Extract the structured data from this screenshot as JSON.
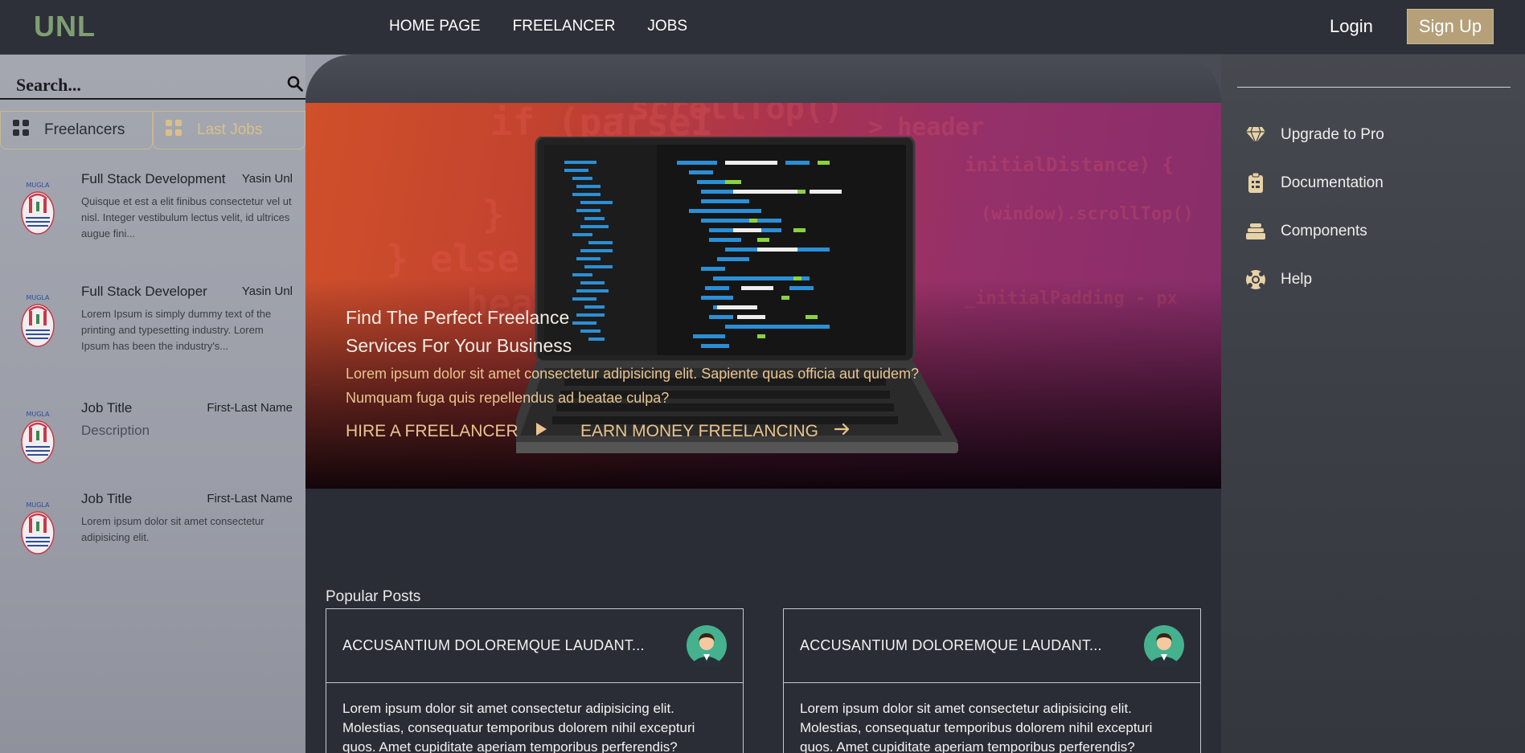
{
  "header": {
    "brand": "UNL",
    "nav": [
      "HOME PAGE",
      "FREELANCER",
      "JOBS"
    ],
    "login": "Login",
    "signup": "Sign Up"
  },
  "sidebar": {
    "search_placeholder": "Search...",
    "tabs": [
      {
        "label": "Freelancers",
        "icon": "grid-icon"
      },
      {
        "label": "Last Jobs",
        "icon": "grid-icon"
      }
    ],
    "jobs": [
      {
        "title": "Full Stack Development",
        "author": "Yasin Unl",
        "description": "Quisque et est a elit finibus consectetur vel ut nisl. Integer vestibulum lectus velit, id ultrices augue fini..."
      },
      {
        "title": "Full Stack Developer",
        "author": "Yasin Unl",
        "description": "Lorem Ipsum is simply dummy text of the printing and typesetting industry. Lorem Ipsum has been the industry's..."
      },
      {
        "title": "Job Title",
        "author": "First-Last Name",
        "description": "Description"
      },
      {
        "title": "Job Title",
        "author": "First-Last Name",
        "description": "Lorem ipsum dolor sit amet consectetur adipisicing elit."
      }
    ],
    "logo_text": "MUGLA"
  },
  "hero": {
    "title": "Find The Perfect Freelance Services For Your Business",
    "text": "Lorem ipsum dolor sit amet consectetur adipisicing elit. Sapiente quas officia aut quidem? Numquam fuga quis repellendus ad beatae culpa?",
    "cta_hire": "HIRE A FREELANCER",
    "cta_earn": "EARN MONEY FREELANCING"
  },
  "popular": {
    "label": "Popular Posts",
    "posts": [
      {
        "title": "ACCUSANTIUM DOLOREMQUE LAUDANT...",
        "body": "Lorem ipsum dolor sit amet consectetur adipisicing elit. Molestias, consequatur temporibus dolorem nihil excepturi quos. Amet cupiditate aperiam temporibus perferendis?"
      },
      {
        "title": "ACCUSANTIUM DOLOREMQUE LAUDANT...",
        "body": "Lorem ipsum dolor sit amet consectetur adipisicing elit. Molestias, consequatur temporibus dolorem nihil excepturi quos. Amet cupiditate aperiam temporibus perferendis?"
      }
    ]
  },
  "rightbar": {
    "items": [
      {
        "label": "Upgrade to Pro",
        "icon": "diamond-icon"
      },
      {
        "label": "Documentation",
        "icon": "clipboard-icon"
      },
      {
        "label": "Components",
        "icon": "layers-icon"
      },
      {
        "label": "Help",
        "icon": "lifebuoy-icon"
      }
    ]
  },
  "colors": {
    "accent": "#b5a07a",
    "brand": "#7f9f73",
    "hero_text": "#e9c48e"
  }
}
